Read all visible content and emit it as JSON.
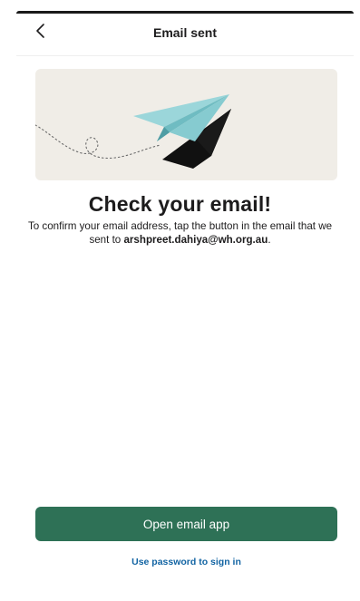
{
  "header": {
    "title": "Email sent",
    "back_icon": "chevron-left-icon"
  },
  "hero": {
    "illustration": "paper-plane-icon"
  },
  "main": {
    "heading": "Check your email!",
    "description_prefix": "To confirm your email address, tap the button in the email that we sent to ",
    "email": "arshpreet.dahiya@wh.org.au",
    "description_suffix": "."
  },
  "actions": {
    "open_email_label": "Open email app",
    "password_link_label": "Use password to sign in"
  },
  "colors": {
    "primary_button": "#2e7156",
    "link": "#1264a3",
    "hero_background": "#f0ede7",
    "plane": "#8ecfd4"
  }
}
